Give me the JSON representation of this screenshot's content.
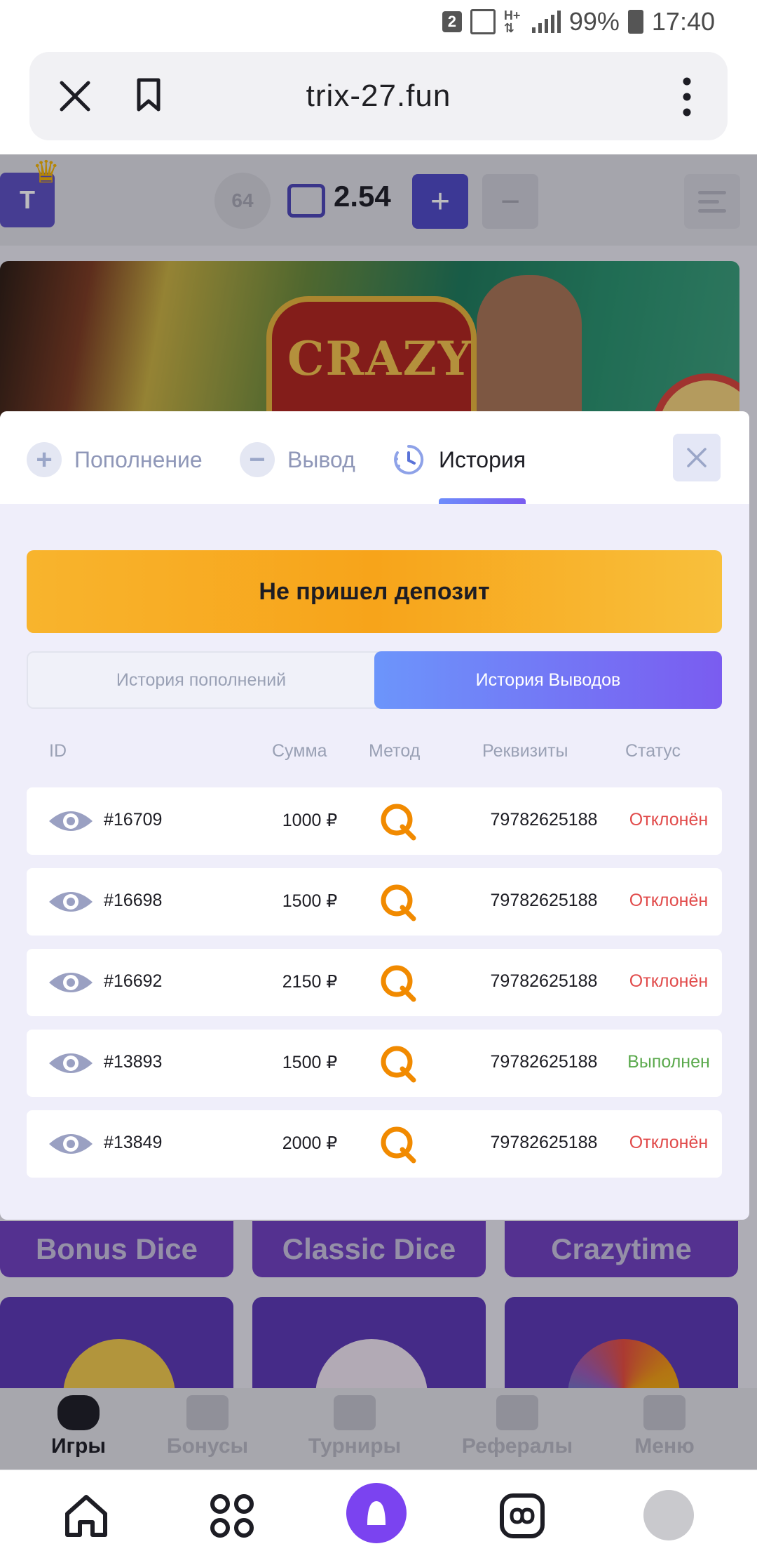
{
  "statusbar": {
    "sim": "2",
    "battery": "99%",
    "time": "17:40"
  },
  "browser": {
    "url": "trix-27.fun"
  },
  "page": {
    "avatar_letter": "T",
    "level": "64",
    "balance": "2.54",
    "plus": "+",
    "minus": "−",
    "games": [
      "Bonus Dice",
      "Classic Dice",
      "Crazytime"
    ],
    "nav": [
      "Игры",
      "Бонусы",
      "Турниры",
      "Рефералы",
      "Меню"
    ]
  },
  "modal": {
    "tabs": {
      "deposit": "Пополнение",
      "withdraw": "Вывод",
      "history": "История"
    },
    "deposit_issue_button": "Не пришел депозит",
    "switcher": {
      "deposits": "История пополнений",
      "withdrawals": "История Выводов"
    },
    "table": {
      "headers": {
        "id": "ID",
        "sum": "Сумма",
        "method": "Метод",
        "details": "Реквизиты",
        "status": "Статус"
      },
      "rows": [
        {
          "id": "#16709",
          "sum": "1000 ₽",
          "details": "79782625188",
          "status": "Отклонён"
        },
        {
          "id": "#16698",
          "sum": "1500 ₽",
          "details": "79782625188",
          "status": "Отклонён"
        },
        {
          "id": "#16692",
          "sum": "2150 ₽",
          "details": "79782625188",
          "status": "Отклонён"
        },
        {
          "id": "#13893",
          "sum": "1500 ₽",
          "details": "79782625188",
          "status": "Выполнен"
        },
        {
          "id": "#13849",
          "sum": "2000 ₽",
          "details": "79782625188",
          "status": "Отклонён"
        }
      ]
    }
  },
  "colors": {
    "accent": "#7a5cf0",
    "orange": "#f7a41a",
    "rejected": "#e14b4b",
    "completed": "#5aa94c",
    "qiwi": "#f18a00"
  }
}
